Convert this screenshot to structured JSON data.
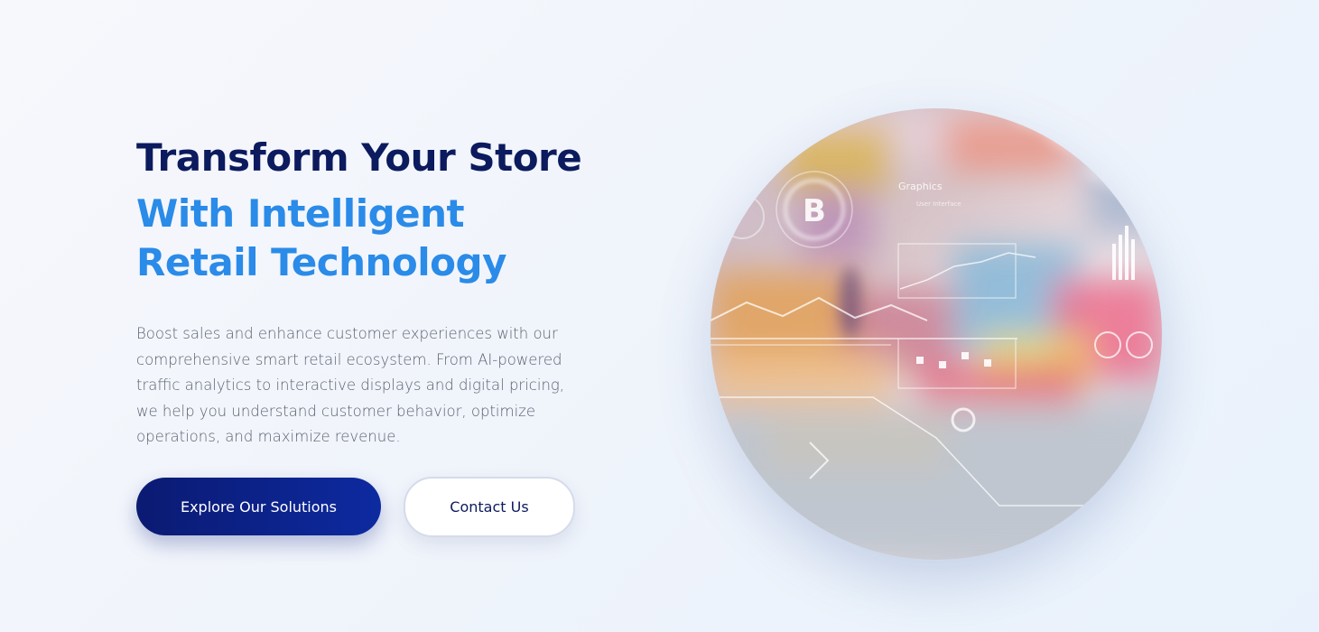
{
  "hero": {
    "title_line1": "Transform Your Store",
    "title_line2": "With Intelligent Retail Technology",
    "description": "Boost sales and enhance customer experiences with our comprehensive smart retail ecosystem. From AI-powered traffic analytics to interactive displays and digital pricing, we help you understand customer behavior, optimize operations, and maximize revenue.",
    "primary_button": "Explore Our Solutions",
    "secondary_button": "Contact Us"
  },
  "visual": {
    "overlay_labels": {
      "graphics": "Graphics",
      "badge_letter": "B",
      "user_interface": "User Interface"
    }
  },
  "colors": {
    "title_dark": "#0c1a5e",
    "title_accent": "#2a8be8",
    "primary_button": "#0b1a72",
    "text_muted": "#5a6270"
  }
}
